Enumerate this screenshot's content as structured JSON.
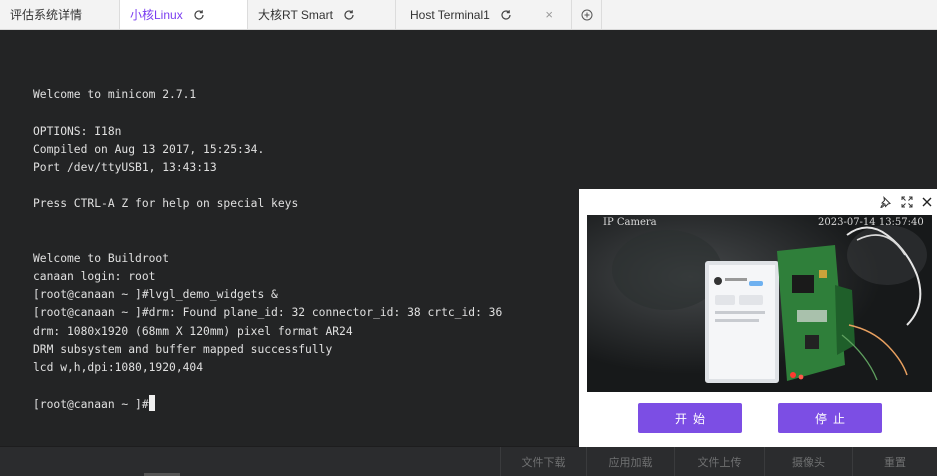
{
  "tabs": [
    {
      "label": "评估系统详情",
      "active": false,
      "refresh": false,
      "closable": false
    },
    {
      "label": "小核Linux",
      "active": true,
      "refresh": true,
      "closable": false
    },
    {
      "label": "大核RT Smart",
      "active": false,
      "refresh": true,
      "closable": false
    },
    {
      "label": "Host Terminal1",
      "active": false,
      "refresh": true,
      "closable": true,
      "close_glyph": "×"
    }
  ],
  "terminal": {
    "lines": [
      "",
      "Welcome to minicom 2.7.1",
      "",
      "OPTIONS: I18n",
      "Compiled on Aug 13 2017, 15:25:34.",
      "Port /dev/ttyUSB1, 13:43:13",
      "",
      "Press CTRL-A Z for help on special keys",
      "",
      "",
      "Welcome to Buildroot",
      "canaan login: root",
      "[root@canaan ~ ]#lvgl_demo_widgets &",
      "[root@canaan ~ ]#drm: Found plane_id: 32 connector_id: 38 crtc_id: 36",
      "drm: 1080x1920 (68mm X 120mm) pixel format AR24",
      "DRM subsystem and buffer mapped successfully",
      "lcd w,h,dpi:1080,1920,404",
      ""
    ],
    "prompt": "[root@canaan ~ ]#"
  },
  "camera": {
    "overlay_label": "IP Camera",
    "overlay_timestamp": "2023-07-14 13:57:40",
    "start_label": "开始",
    "stop_label": "停止"
  },
  "bottom_bar": {
    "buttons": [
      "文件下载",
      "应用加载",
      "文件上传",
      "摄像头",
      "重置"
    ]
  },
  "colors": {
    "accent": "#7c4ee4",
    "active_tab_text": "#7a3df0",
    "terminal_bg": "#232425",
    "terminal_text": "#e0e0e0"
  }
}
